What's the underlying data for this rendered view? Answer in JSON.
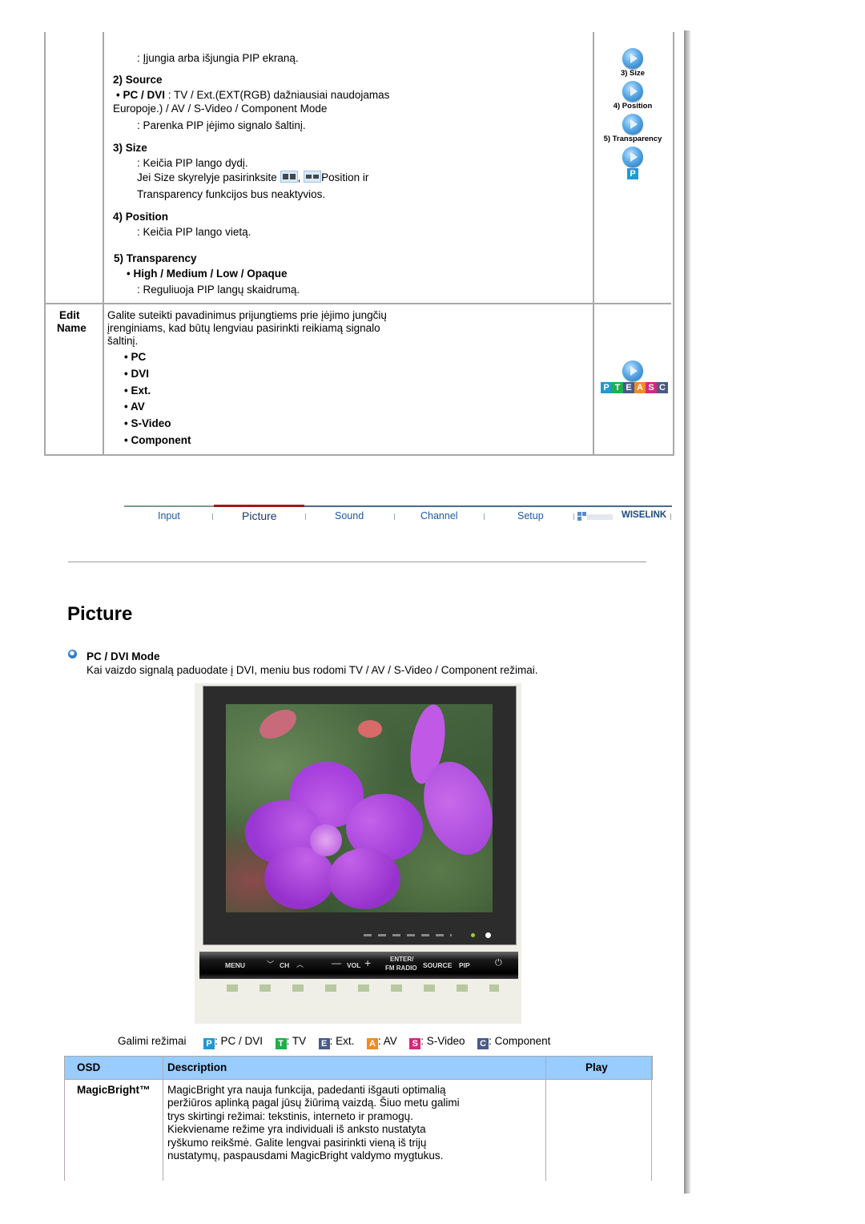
{
  "pip_table": {
    "intro_line": ": Įjungia arba išjungia PIP ekraną.",
    "source": {
      "heading": "2) Source",
      "bullet_label": "• PC / DVI",
      "bullet_text": " : TV / Ext.(EXT(RGB) dažniausiai naudojamas",
      "bullet_text_2": "Europoje.) / AV / S-Video / Component Mode",
      "desc": ": Parenka PIP įėjimo signalo šaltinį."
    },
    "size": {
      "heading": "3) Size",
      "desc": ": Keičia PIP lango dydį.",
      "line2_a": "Jei Size skyrelyje pasirinksite",
      "line2_sep": ",",
      "line2_b": "Position ir",
      "line3": "Transparency funkcijos bus neaktyvios."
    },
    "position": {
      "heading": "4) Position",
      "desc": ": Keičia PIP lango vietą."
    },
    "transparency": {
      "heading": "5) Transparency",
      "options": "• High / Medium / Low / Opaque",
      "desc": ": Reguliuoja PIP langų skaidrumą."
    },
    "side_buttons": [
      {
        "label": "3) Size"
      },
      {
        "label": "4) Position"
      },
      {
        "label": "5) Transparency"
      }
    ],
    "side_badge": "P",
    "edit_name": {
      "label_1": "Edit",
      "label_2": "Name",
      "desc_1": "Galite suteikti pavadinimus prijungtiems prie įėjimo jungčių",
      "desc_2": "įrenginiams, kad būtų lengviau pasirinkti reikiamą signalo",
      "desc_3": "šaltinį.",
      "items": [
        "• PC",
        "• DVI",
        "• Ext.",
        "• AV",
        "• S-Video",
        "• Component"
      ],
      "badges": [
        "P",
        "T",
        "E",
        "A",
        "S",
        "C"
      ]
    }
  },
  "nav": {
    "items": [
      {
        "label": "Input"
      },
      {
        "label": "Picture"
      },
      {
        "label": "Sound"
      },
      {
        "label": "Channel"
      },
      {
        "label": "Setup"
      },
      {
        "label": "WISELINK"
      }
    ],
    "active": "Picture",
    "active_color": "#a01818"
  },
  "section": {
    "title": "Picture",
    "subheading": "PC / DVI Mode",
    "subtext": "Kai vaizdo signalą paduodate į DVI, meniu bus rodomi TV / AV / S-Video / Component režimai."
  },
  "monitor": {
    "buttons": [
      "MENU",
      "CH",
      "VOL",
      "ENTER/",
      "FM RADIO",
      "SOURCE",
      "PIP"
    ]
  },
  "modes": {
    "label": "Galimi režimai",
    "items": [
      {
        "badge": "P",
        "text": ": PC / DVI",
        "color": "#1e9ad6"
      },
      {
        "badge": "T",
        "text": ": TV",
        "color": "#1fb04a"
      },
      {
        "badge": "E",
        "text": ": Ext.",
        "color": "#4a5a86"
      },
      {
        "badge": "A",
        "text": ": AV",
        "color": "#f08a24"
      },
      {
        "badge": "S",
        "text": ": S-Video",
        "color": "#d6287a"
      },
      {
        "badge": "C",
        "text": ": Component",
        "color": "#4a5a86"
      }
    ]
  },
  "osd_table": {
    "headers": {
      "osd": "OSD",
      "description": "Description",
      "play": "Play"
    },
    "header_color": "#99ccff",
    "rows": [
      {
        "osd": "MagicBright™",
        "description": [
          "MagicBright yra nauja funkcija, padedanti išgauti optimalią",
          "peržiūros aplinką pagal jūsų žiūrimą vaizdą. Šiuo metu galimi",
          "trys skirtingi režimai: tekstinis, interneto ir pramogų.",
          "Kiekviename režime yra individuali iš anksto nustatyta",
          "ryškumo reikšmė. Galite lengvai pasirinkti vieną iš trijų",
          "nustatymų, paspausdami MagicBright valdymo mygtukus."
        ]
      }
    ]
  }
}
